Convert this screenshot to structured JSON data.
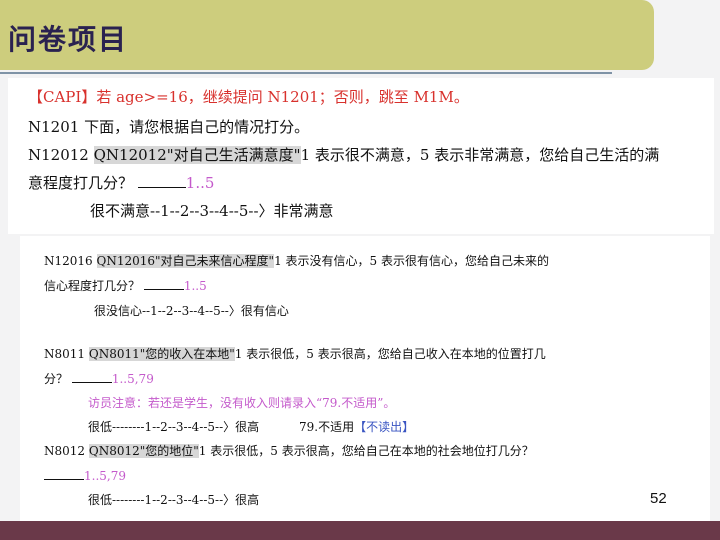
{
  "header": {
    "title": "问卷项目"
  },
  "block1": {
    "capi_line": "【CAPI】若 age>=16，继续提问 N1201；否则，跳至 M1M。",
    "n1201": "N1201 下面，请您根据自己的情况打分。",
    "n12012_code": "N12012",
    "n12012_tag": "QN12012\"对自己生活满意度\"",
    "n12012_text": "1 表示很不满意，5 表示非常满意，您给自己生活的满",
    "n12012_line2": "意程度打几分？",
    "n12012_range": "1..5",
    "n12012_scale": "很不满意--1--2--3--4--5--〉非常满意"
  },
  "block2": {
    "n12016_code": "N12016",
    "n12016_tag": "QN12016\"对自己未来信心程度\"",
    "n12016_text": "1 表示没有信心，5 表示很有信心，您给自己未来的",
    "n12016_line2": "信心程度打几分？",
    "n12016_range": "1..5",
    "n12016_scale": "很没信心--1--2--3--4--5--〉很有信心",
    "n8011_code": "N8011",
    "n8011_tag": "QN8011\"您的收入在本地\"",
    "n8011_text": "1 表示很低，5 表示很高，您给自己收入在本地的位置打几",
    "n8011_line2": "分？",
    "n8011_range": "1..5,79",
    "n8011_note": "访员注意：若还是学生，没有收入则请录入“79.不适用”。",
    "n8011_scale": "很低--------1--2--3--4--5--〉很高",
    "n8011_na": "79.不适用",
    "n8011_noread": "【不读出】",
    "n8012_code": "N8012",
    "n8012_tag": "QN8012\"您的地位\"",
    "n8012_text": "1 表示很低，5 表示很高，您给自己在本地的社会地位打几分？",
    "n8012_range": "1..5,79",
    "n8012_scale": "很低--------1--2--3--4--5--〉很高"
  },
  "footer": {
    "page_number": "52"
  },
  "colors": {
    "title_bar": "#cdcd7d",
    "title_text": "#2a2250",
    "bottom_bar": "#6a3949",
    "red": "#d8312d",
    "purple": "#c45acb",
    "blue": "#3a55c2"
  }
}
